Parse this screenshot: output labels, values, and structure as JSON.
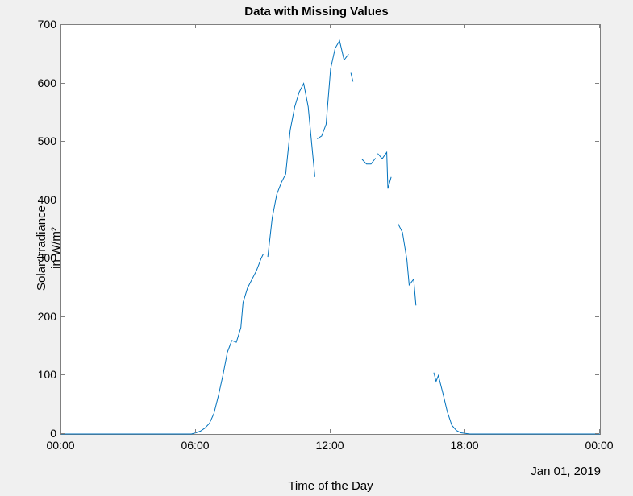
{
  "chart_data": {
    "type": "line",
    "title": "Data with Missing Values",
    "xlabel": "Time of the Day",
    "ylabel": "Solar Irradiance\nin W/m²",
    "date_annotation": "Jan 01, 2019",
    "xlim": [
      0,
      24
    ],
    "ylim": [
      0,
      700
    ],
    "xticks": [
      "00:00",
      "06:00",
      "12:00",
      "18:00",
      "00:00"
    ],
    "yticks": [
      0,
      100,
      200,
      300,
      400,
      500,
      600,
      700
    ],
    "segments": [
      {
        "x": [
          0.0,
          5.8,
          6.0,
          6.2,
          6.4,
          6.6,
          6.8,
          7.0,
          7.2,
          7.4,
          7.6,
          7.8,
          8.0,
          8.1,
          8.3,
          8.5,
          8.7,
          8.9,
          9.0
        ],
        "y": [
          0,
          0,
          2,
          5,
          10,
          18,
          35,
          65,
          100,
          140,
          160,
          157,
          182,
          225,
          250,
          265,
          280,
          300,
          308
        ]
      },
      {
        "x": [
          9.2,
          9.4,
          9.6,
          9.8,
          10.0,
          10.2,
          10.4,
          10.6,
          10.8,
          11.0,
          11.2,
          11.3
        ],
        "y": [
          303,
          370,
          410,
          430,
          445,
          520,
          560,
          585,
          600,
          560,
          480,
          440
        ]
      },
      {
        "x": [
          11.4,
          11.6,
          11.8,
          12.0,
          12.2,
          12.4,
          12.6,
          12.8
        ],
        "y": [
          505,
          510,
          530,
          625,
          660,
          673,
          640,
          650
        ]
      },
      {
        "x": [
          12.9,
          13.0
        ],
        "y": [
          618,
          603
        ]
      },
      {
        "x": [
          13.4,
          13.6,
          13.8,
          14.0
        ],
        "y": [
          470,
          462,
          462,
          472
        ]
      },
      {
        "x": [
          14.1,
          14.3,
          14.5,
          14.55,
          14.7
        ],
        "y": [
          480,
          471,
          482,
          420,
          440
        ]
      },
      {
        "x": [
          15.0,
          15.2,
          15.4,
          15.5,
          15.7,
          15.8
        ],
        "y": [
          360,
          345,
          298,
          255,
          265,
          220
        ]
      },
      {
        "x": [
          16.6,
          16.7,
          16.8,
          17.0,
          17.2,
          17.4,
          17.6,
          17.8,
          18.2,
          24.0
        ],
        "y": [
          105,
          90,
          100,
          70,
          38,
          15,
          6,
          2,
          0,
          0
        ]
      }
    ]
  }
}
